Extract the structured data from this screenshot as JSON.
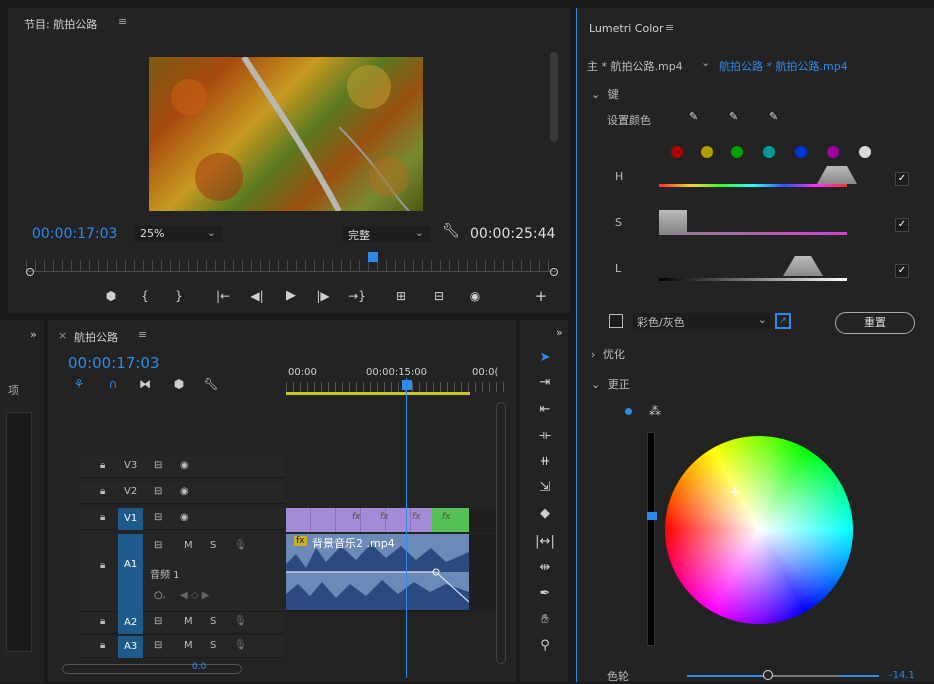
{
  "program_monitor": {
    "title": "节目: 航拍公路",
    "menu_icon": "≡",
    "timecode_current": "00:00:17:03",
    "zoom": "25%",
    "quality": "完整",
    "timecode_total": "00:00:25:44"
  },
  "timeline": {
    "left_label": "项",
    "tab_label": "航拍公路",
    "menu_icon": "≡",
    "timecode": "00:00:17:03",
    "ruler": [
      "00:00",
      "00:00:15:00",
      "00:0("
    ],
    "tracks": [
      {
        "id": "V3",
        "name": "V3"
      },
      {
        "id": "V2",
        "name": "V2"
      },
      {
        "id": "V1",
        "name": "V1"
      },
      {
        "id": "A1",
        "name": "A1",
        "label": "音频 1"
      },
      {
        "id": "A2",
        "name": "A2"
      },
      {
        "id": "A3",
        "name": "A3"
      }
    ],
    "audio_clip_name": "背景音乐2 .mp4",
    "fx_label": "fx",
    "m_label": "M",
    "s_label": "S",
    "bottom_value": "0.0"
  },
  "lumetri": {
    "title": "Lumetri Color",
    "menu_icon": "≡",
    "source_master": "主 * 航拍公路.mp4",
    "source_clip": "航拍公路 * 航拍公路.mp4",
    "section_key": "键",
    "set_color_label": "设置颜色",
    "h_label": "H",
    "s_label": "S",
    "l_label": "L",
    "color_gray": "彩色/灰色",
    "reset_button": "重置",
    "section_refine": "优化",
    "section_correction": "更正",
    "wheel_label": "色轮",
    "wheel_value": "-14.1",
    "swatches": [
      "#b00000",
      "#b0a000",
      "#00a000",
      "#009a9a",
      "#0030d8",
      "#a000a0",
      "#d8d8d8"
    ]
  }
}
